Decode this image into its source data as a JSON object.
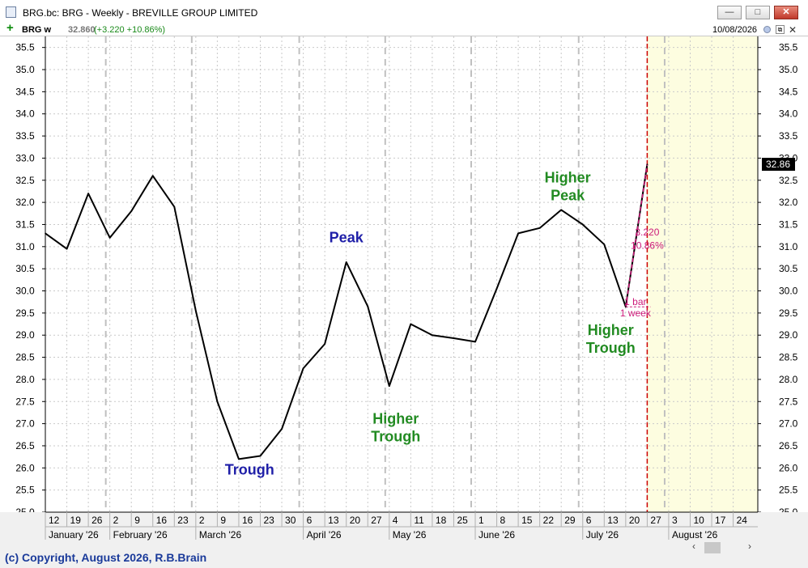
{
  "window": {
    "title": "BRG.bc: BRG - Weekly - BREVILLE GROUP LIMITED",
    "min_glyph": "—",
    "max_glyph": "□",
    "close_glyph": "✕"
  },
  "infobar": {
    "symbol": "BRG w",
    "price": "32.860",
    "change": "(+3.220 +10.86%)",
    "date": "10/08/2026",
    "plus_glyph": "+",
    "restore_glyph": "⧉",
    "close_glyph": "✕"
  },
  "copyright": "(c) Copyright, August 2026, R.B.Brain",
  "scrollbar": {
    "left_glyph": "‹",
    "right_glyph": "›"
  },
  "chart_data": {
    "type": "line",
    "ylim": [
      25.0,
      35.75
    ],
    "ytick_values": [
      25.0,
      25.5,
      26.0,
      26.5,
      27.0,
      27.5,
      28.0,
      28.5,
      29.0,
      29.5,
      30.0,
      30.5,
      31.0,
      31.5,
      32.0,
      32.5,
      33.0,
      33.5,
      34.0,
      34.5,
      35.0,
      35.5
    ],
    "ytick_labels": [
      "25.0",
      "25.5",
      "26.0",
      "26.5",
      "27.0",
      "27.5",
      "28.0",
      "28.5",
      "29.0",
      "29.5",
      "30.0",
      "30.5",
      "31.0",
      "31.5",
      "32.0",
      "32.5",
      "33.0",
      "33.5",
      "34.0",
      "34.5",
      "35.0",
      "35.5"
    ],
    "x_day_labels": [
      "12",
      "19",
      "26",
      "2",
      "9",
      "16",
      "23",
      "2",
      "9",
      "16",
      "23",
      "30",
      "6",
      "13",
      "20",
      "27",
      "4",
      "11",
      "18",
      "25",
      "1",
      "8",
      "15",
      "22",
      "29",
      "6",
      "13",
      "20",
      "27",
      "3",
      "10",
      "17",
      "24"
    ],
    "month_labels": [
      {
        "label": "January '26",
        "index": 0
      },
      {
        "label": "February '26",
        "index": 3
      },
      {
        "label": "March '26",
        "index": 7
      },
      {
        "label": "April '26",
        "index": 12
      },
      {
        "label": "May '26",
        "index": 16
      },
      {
        "label": "June '26",
        "index": 20
      },
      {
        "label": "July '26",
        "index": 25
      },
      {
        "label": "August '26",
        "index": 29
      }
    ],
    "month_separator_indices": [
      3,
      7,
      12,
      16,
      20,
      25,
      29
    ],
    "values": [
      31.3,
      30.95,
      32.2,
      31.2,
      31.8,
      32.6,
      31.9,
      29.55,
      27.5,
      26.2,
      26.27,
      26.88,
      28.25,
      28.8,
      30.65,
      29.65,
      27.85,
      29.25,
      29.0,
      28.93,
      28.85,
      30.05,
      31.3,
      31.42,
      31.83,
      31.5,
      31.05,
      29.64,
      32.86
    ],
    "last_value_label": "32.86",
    "current_bar_index": 28,
    "annotations": [
      {
        "text": "Peak",
        "index": 14,
        "value": 31.1,
        "color": "#1f1fa8",
        "lines": [
          "Peak"
        ]
      },
      {
        "text": "Trough",
        "index": 9.5,
        "value": 25.85,
        "color": "#1f1fa8",
        "lines": [
          "Trough"
        ]
      },
      {
        "text": "Higher Trough",
        "index": 16.3,
        "value": 27.0,
        "color": "#228b22",
        "lines": [
          "Higher",
          "Trough"
        ]
      },
      {
        "text": "Higher Peak",
        "index": 24.3,
        "value": 32.45,
        "color": "#228b22",
        "lines": [
          "Higher",
          "Peak"
        ]
      },
      {
        "text": "Higher Trough",
        "index": 26.3,
        "value": 29.0,
        "color": "#228b22",
        "lines": [
          "Higher",
          "Trough"
        ]
      }
    ],
    "measure_tool": {
      "change": "3.220",
      "percent": "10.86%",
      "bars": "1 bar",
      "period": "1 week",
      "from_index": 27,
      "from_value": 29.64,
      "to_index": 28,
      "to_value": 32.86,
      "color": "#cc1a7a"
    },
    "colors": {
      "line": "#000000",
      "future_fill": "#fdfde0",
      "current_bar_line": "#cc0000",
      "grid": "#c9c9c9",
      "month_separator": "#c0c0c0",
      "last_value_bg": "#000000"
    }
  }
}
